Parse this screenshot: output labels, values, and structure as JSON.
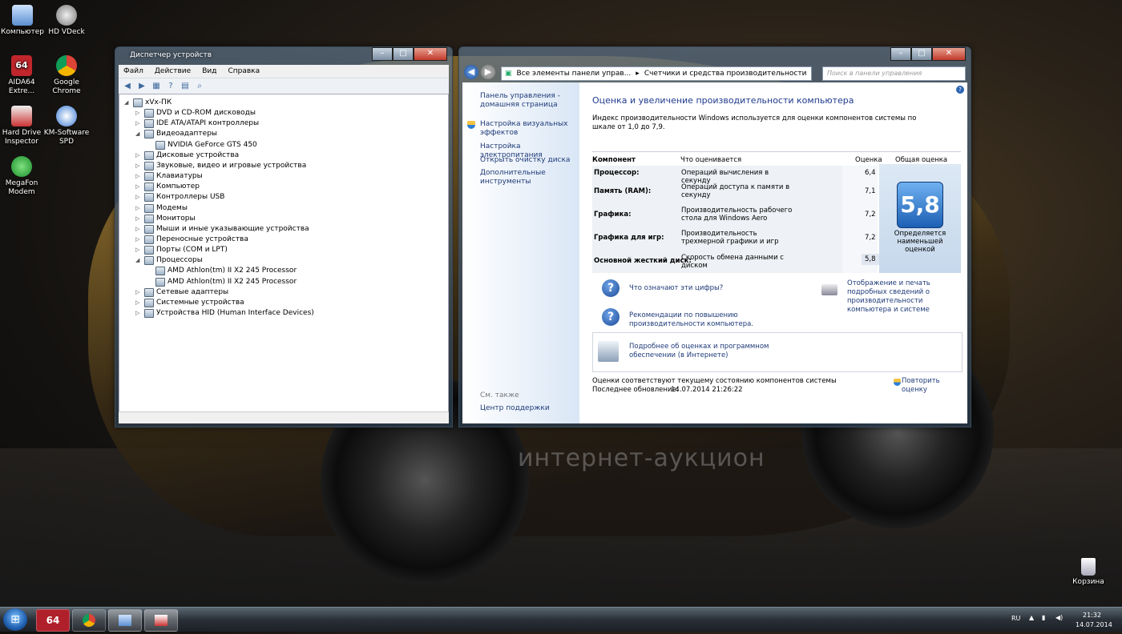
{
  "desktop_icons": [
    {
      "label": "Компьютер",
      "icon": "computer-icon"
    },
    {
      "label": "HD VDeck",
      "icon": "hd-vdeck-icon"
    },
    {
      "label": "AIDA64 Extre...",
      "icon": "aida64-icon"
    },
    {
      "label": "Google Chrome",
      "icon": "chrome-icon"
    },
    {
      "label": "Hard Drive Inspector",
      "icon": "hard-drive-inspector-icon"
    },
    {
      "label": "KM-Software SPD",
      "icon": "km-software-icon"
    },
    {
      "label": "MegaFon Modem",
      "icon": "megafon-icon"
    },
    {
      "label": "Корзина",
      "icon": "recycle-bin-icon"
    }
  ],
  "watermark": "интернет-аукцион",
  "devmgr": {
    "title": "Диспетчер устройств",
    "menu": [
      "Файл",
      "Действие",
      "Вид",
      "Справка"
    ],
    "tree": [
      {
        "label": "xVx-ПК",
        "level": 0,
        "expanded": true
      },
      {
        "label": "DVD и CD-ROM дисководы",
        "level": 1
      },
      {
        "label": "IDE ATA/ATAPI контроллеры",
        "level": 1
      },
      {
        "label": "Видеоадаптеры",
        "level": 1,
        "expanded": true
      },
      {
        "label": "NVIDIA GeForce GTS 450",
        "level": 2
      },
      {
        "label": "Дисковые устройства",
        "level": 1
      },
      {
        "label": "Звуковые, видео и игровые устройства",
        "level": 1
      },
      {
        "label": "Клавиатуры",
        "level": 1
      },
      {
        "label": "Компьютер",
        "level": 1
      },
      {
        "label": "Контроллеры USB",
        "level": 1
      },
      {
        "label": "Модемы",
        "level": 1
      },
      {
        "label": "Мониторы",
        "level": 1
      },
      {
        "label": "Мыши и иные указывающие устройства",
        "level": 1
      },
      {
        "label": "Переносные устройства",
        "level": 1
      },
      {
        "label": "Порты (COM и LPT)",
        "level": 1
      },
      {
        "label": "Процессоры",
        "level": 1,
        "expanded": true
      },
      {
        "label": "AMD Athlon(tm) II X2 245 Processor",
        "level": 2
      },
      {
        "label": "AMD Athlon(tm) II X2 245 Processor",
        "level": 2
      },
      {
        "label": "Сетевые адаптеры",
        "level": 1
      },
      {
        "label": "Системные устройства",
        "level": 1
      },
      {
        "label": "Устройства HID (Human Interface Devices)",
        "level": 1
      }
    ]
  },
  "perf": {
    "breadcrumb1": "Все элементы панели управ...",
    "breadcrumb2": "Счетчики и средства производительности",
    "search_placeholder": "Поиск в панели управления",
    "sidebar_links": [
      "Панель управления - домашняя страница",
      "Настройка визуальных эффектов",
      "Настройка электропитания",
      "Открыть очистку диска",
      "Дополнительные инструменты"
    ],
    "see_also": "См. также",
    "support_center": "Центр поддержки",
    "heading": "Оценка и увеличение производительности компьютера",
    "intro": "Индекс производительности Windows используется для оценки компонентов системы по шкале от 1,0 до 7,9.",
    "col_component": "Компонент",
    "col_what": "Что оценивается",
    "col_score": "Оценка",
    "col_overall": "Общая оценка",
    "rows": [
      {
        "component": "Процессор:",
        "what": "Операций вычисления в секунду",
        "score": "6,4"
      },
      {
        "component": "Память (RAM):",
        "what": "Операций доступа к памяти в секунду",
        "score": "7,1"
      },
      {
        "component": "Графика:",
        "what": "Производительность рабочего стола для Windows Aero",
        "score": "7,2"
      },
      {
        "component": "Графика для игр:",
        "what": "Производительность трехмерной графики и игр",
        "score": "7,2"
      },
      {
        "component": "Основной жесткий диск:",
        "what": "Скорость обмена данными с диском",
        "score": "5,8"
      }
    ],
    "overall_score": "5,8",
    "overall_note": "Определяется наименьшей оценкой",
    "link_what": "Что означают эти цифры?",
    "link_print": "Отображение и печать подробных сведений о производительности компьютера и системе",
    "link_tips": "Рекомендации по повышению производительности компьютера.",
    "link_more": "Подробнее об оценках и программном обеспечении (в Интернете)",
    "status_line": "Оценки соответствуют текущему состоянию компонентов системы",
    "last_update_label": "Последнее обновление:",
    "last_update": "14.07.2014 21:26:22",
    "rerun": "Повторить оценку"
  },
  "taskbar": {
    "lang": "RU",
    "time": "21:32",
    "date": "14.07.2014",
    "aida_label": "64"
  }
}
